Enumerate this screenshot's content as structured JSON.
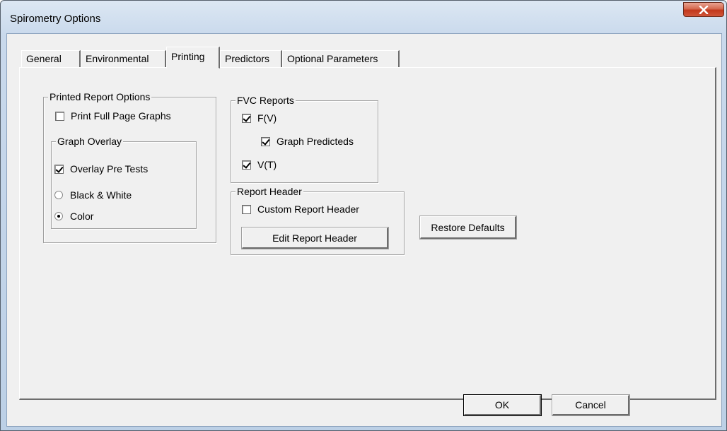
{
  "window": {
    "title": "Spirometry Options",
    "close_symbol": "X"
  },
  "tabs": [
    {
      "label": "General",
      "active": false
    },
    {
      "label": "Environmental",
      "active": false
    },
    {
      "label": "Printing",
      "active": true
    },
    {
      "label": "Predictors",
      "active": false
    },
    {
      "label": "Optional Parameters",
      "active": false
    }
  ],
  "printed_report_options": {
    "title": "Printed Report Options",
    "print_full_page_graphs": {
      "label": "Print Full Page Graphs",
      "checked": false
    },
    "graph_overlay": {
      "title": "Graph Overlay",
      "overlay_pre_tests": {
        "label": "Overlay Pre Tests",
        "checked": true
      },
      "black_white": {
        "label": "Black & White",
        "selected": false
      },
      "color": {
        "label": "Color",
        "selected": true
      }
    }
  },
  "fvc_reports": {
    "title": "FVC Reports",
    "fv": {
      "label": "F(V)",
      "checked": true
    },
    "graph_predicteds": {
      "label": "Graph Predicteds",
      "checked": true
    },
    "vt": {
      "label": "V(T)",
      "checked": true
    }
  },
  "report_header": {
    "title": "Report Header",
    "custom_report_header": {
      "label": "Custom Report Header",
      "checked": false
    },
    "edit_button": "Edit Report Header"
  },
  "restore_defaults_button": "Restore Defaults",
  "footer": {
    "ok_label": "OK",
    "cancel_label": "Cancel"
  }
}
